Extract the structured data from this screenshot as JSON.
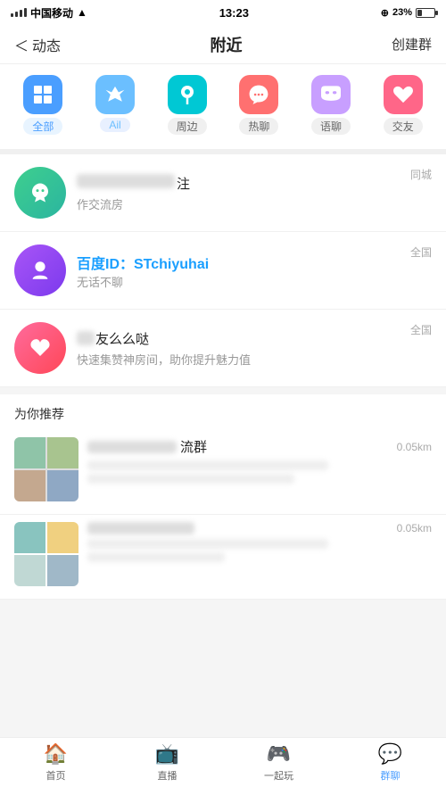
{
  "statusBar": {
    "carrier": "中国移动",
    "time": "13:23",
    "battery": "23%"
  },
  "navBar": {
    "back": "动态",
    "title": "附近",
    "action": "创建群"
  },
  "categories": [
    {
      "id": "all",
      "label": "全部",
      "icon": "grid",
      "active": true
    },
    {
      "id": "wolf",
      "label": "",
      "icon": "wolf",
      "active": false
    },
    {
      "id": "nearby",
      "label": "周边",
      "icon": "location",
      "active": false
    },
    {
      "id": "hot",
      "label": "热聊",
      "icon": "chat",
      "active": false
    },
    {
      "id": "voice",
      "label": "语聊",
      "icon": "mask",
      "active": false
    },
    {
      "id": "friend",
      "label": "交友",
      "icon": "heart",
      "active": false
    }
  ],
  "groups": [
    {
      "id": 1,
      "nameBlurred": true,
      "nameSuffix": "注",
      "subTitle": "作交流房",
      "tag": "同城",
      "avatar": "green",
      "avatarIcon": "🌱"
    },
    {
      "id": 2,
      "nameBlurred": false,
      "nameText": "百度ID：STchiyuhai",
      "subTitle": "无话不聊",
      "tag": "全国",
      "avatar": "purple",
      "avatarIcon": "☕"
    },
    {
      "id": 3,
      "nameBlurred": false,
      "nameSuffix": "友么么哒",
      "prefixBlurred": true,
      "subTitle": "快速集赞神房间，助你提升魅力值",
      "tag": "全国",
      "avatar": "pink",
      "avatarIcon": "💝"
    }
  ],
  "recommend": {
    "header": "为你推荐",
    "items": [
      {
        "id": 1,
        "nameSuffix": "流群",
        "nameBlurred": true,
        "distance": "0.05km",
        "subBlurred": true
      },
      {
        "id": 2,
        "nameBlurred": true,
        "distance": "0.05km",
        "subBlurred": true
      }
    ]
  },
  "tabBar": {
    "items": [
      {
        "id": "home",
        "label": "首页",
        "icon": "🏠",
        "active": false
      },
      {
        "id": "live",
        "label": "直播",
        "icon": "📺",
        "active": false
      },
      {
        "id": "play",
        "label": "一起玩",
        "icon": "🎮",
        "active": false
      },
      {
        "id": "group",
        "label": "群聊",
        "icon": "💬",
        "active": true
      }
    ]
  }
}
